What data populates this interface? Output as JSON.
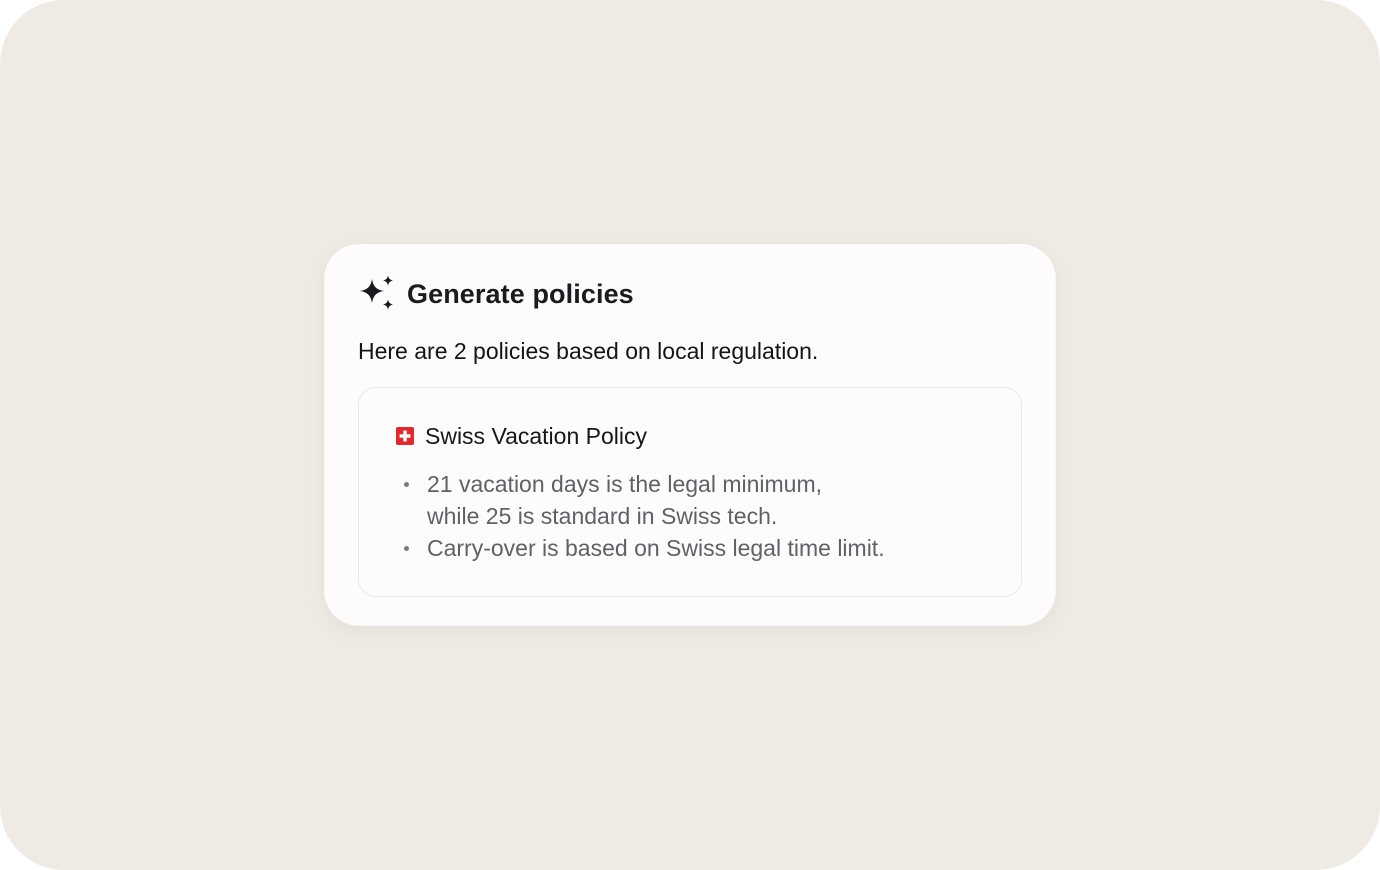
{
  "card": {
    "title": "Generate policies",
    "title_icon": "sparkle-icon",
    "intro": "Here are 2 policies based on local regulation."
  },
  "policy": {
    "flag_icon": "swiss-flag-icon",
    "title": "Swiss Vacation Policy",
    "bullets": [
      {
        "line1": "21 vacation days is the legal minimum,",
        "line2": "while 25 is standard in Swiss tech."
      },
      {
        "line1": "Carry-over is based on Swiss legal time limit."
      }
    ]
  },
  "colors": {
    "background": "#efeae4",
    "card": "#fdfbfb",
    "flag_red": "#e4282c",
    "title_text": "#1b1b1f",
    "bullet_text": "#626066"
  }
}
